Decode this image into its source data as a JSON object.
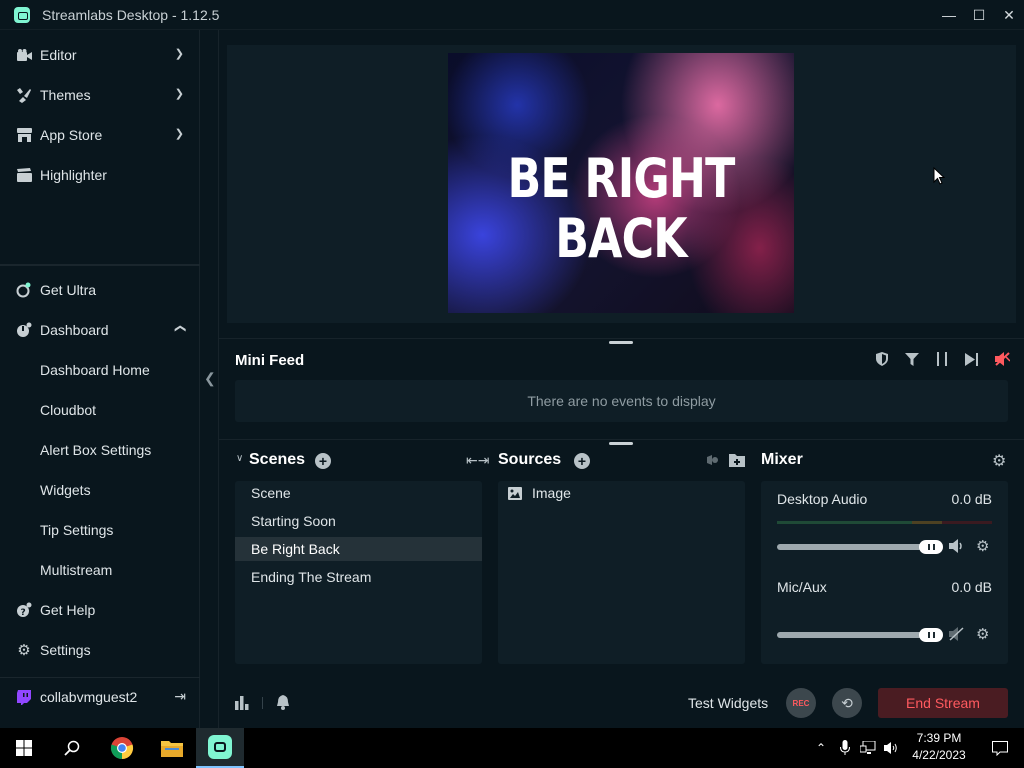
{
  "window": {
    "title": "Streamlabs Desktop - 1.12.5",
    "minimize": "—",
    "maximize": "☐",
    "close": "✕"
  },
  "sidebar": {
    "top_items": [
      {
        "label": "Editor",
        "icon": "camera-icon"
      },
      {
        "label": "Themes",
        "icon": "brush-icon"
      },
      {
        "label": "App Store",
        "icon": "store-icon"
      },
      {
        "label": "Highlighter",
        "icon": "clapper-icon"
      }
    ],
    "bottom_items": {
      "get_ultra": "Get Ultra",
      "dashboard": "Dashboard",
      "dashboard_sub": [
        "Dashboard Home",
        "Cloudbot",
        "Alert Box Settings",
        "Widgets",
        "Tip Settings",
        "Multistream"
      ],
      "get_help": "Get Help",
      "settings": "Settings",
      "user": "collabvmguest2"
    }
  },
  "preview": {
    "overlay_text": "BE RIGHT BACK"
  },
  "minifeed": {
    "title": "Mini Feed",
    "empty_text": "There are no events to display"
  },
  "scenes": {
    "title": "Scenes",
    "items": [
      "Scene",
      "Starting Soon",
      "Be Right Back",
      "Ending The Stream"
    ],
    "active": "Be Right Back"
  },
  "sources": {
    "title": "Sources",
    "items": [
      "Image"
    ]
  },
  "mixer": {
    "title": "Mixer",
    "channels": [
      {
        "name": "Desktop Audio",
        "db": "0.0 dB",
        "level": 1.0
      },
      {
        "name": "Mic/Aux",
        "db": "0.0 dB",
        "level": 1.0
      }
    ]
  },
  "footer": {
    "test_widgets": "Test Widgets",
    "rec": "REC",
    "end_stream": "End Stream"
  },
  "taskbar": {
    "time": "7:39 PM",
    "date": "4/22/2023"
  },
  "colors": {
    "accent": "#80f5d2",
    "end_stream_bg": "#4a1c22",
    "end_stream_text": "#ff5a5f"
  }
}
